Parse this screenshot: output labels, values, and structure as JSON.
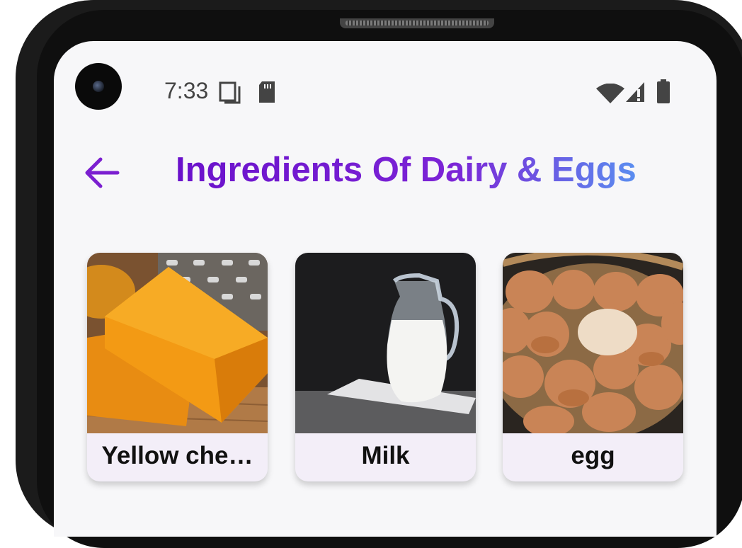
{
  "status_bar": {
    "time": "7:33",
    "icons": [
      "screen-icon",
      "sd-card-icon",
      "wifi-icon",
      "signal-icon",
      "battery-icon"
    ]
  },
  "header": {
    "title": "Ingredients Of Dairy & Eggs",
    "back_icon": "arrow-back-icon",
    "accent_color": "#7b1fd0",
    "gradient_end": "#5a8ef0"
  },
  "ingredients": [
    {
      "label": "Yellow che…",
      "image": "yellow-cheese-photo"
    },
    {
      "label": "Milk",
      "image": "milk-jug-photo"
    },
    {
      "label": "egg",
      "image": "egg-basket-photo"
    }
  ]
}
